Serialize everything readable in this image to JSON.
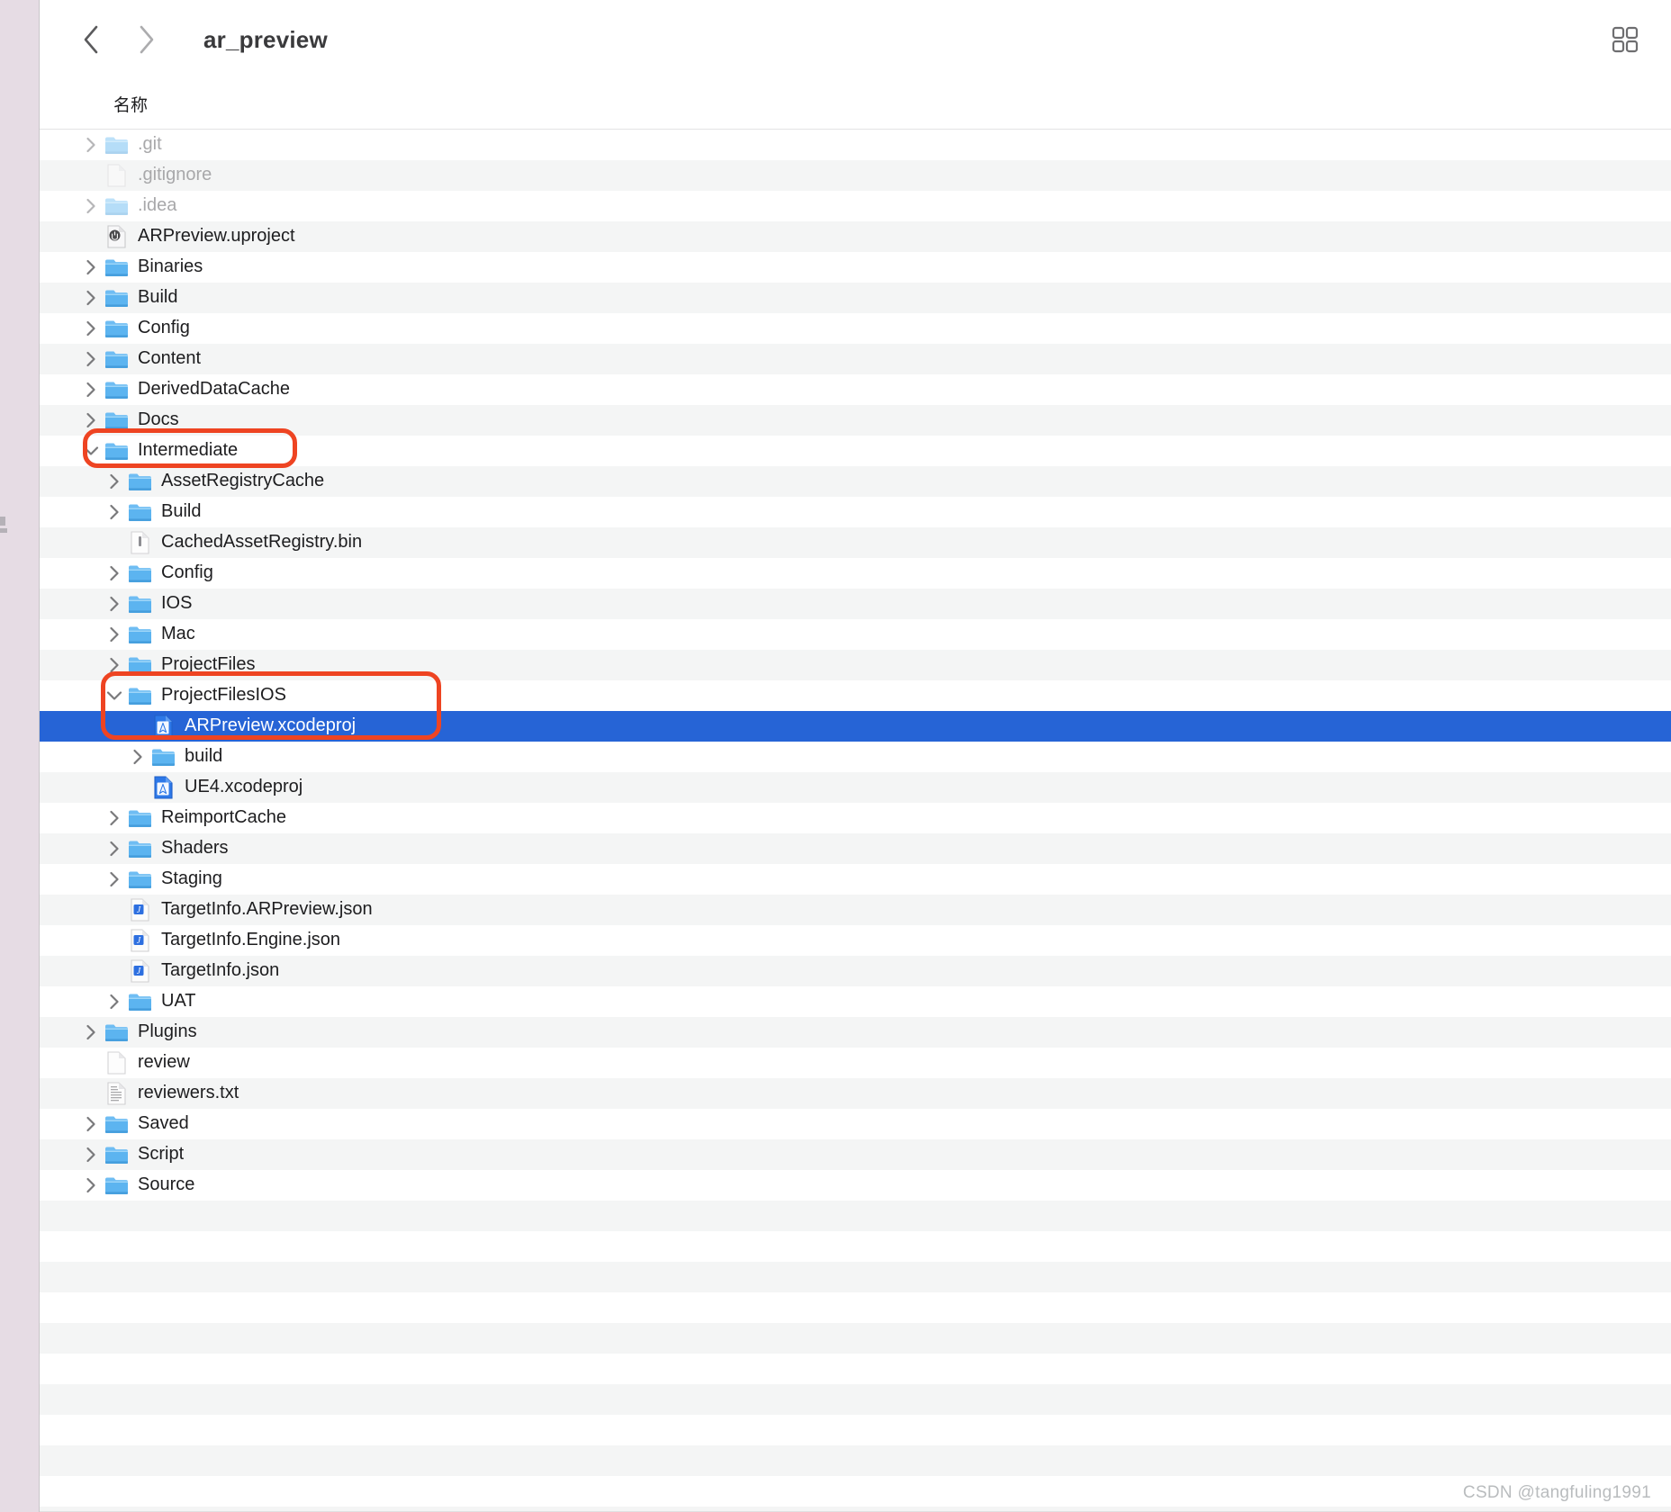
{
  "window": {
    "title": "ar_preview",
    "back_icon": "chevron-left-icon",
    "forward_icon": "chevron-right-icon",
    "view_toggle_icon": "grid-view-icon"
  },
  "column_header": {
    "name": "名称"
  },
  "rows": [
    {
      "name": ".git",
      "indent": 0,
      "type": "folder",
      "state": "collapsed",
      "dim": true,
      "selected": false
    },
    {
      "name": ".gitignore",
      "indent": 0,
      "type": "blankdoc",
      "state": "leaf",
      "dim": true,
      "selected": false
    },
    {
      "name": ".idea",
      "indent": 0,
      "type": "folder",
      "state": "collapsed",
      "dim": true,
      "selected": false
    },
    {
      "name": "ARPreview.uproject",
      "indent": 0,
      "type": "uproject",
      "state": "leaf",
      "dim": false,
      "selected": false
    },
    {
      "name": "Binaries",
      "indent": 0,
      "type": "folder",
      "state": "collapsed",
      "dim": false,
      "selected": false
    },
    {
      "name": "Build",
      "indent": 0,
      "type": "folder",
      "state": "collapsed",
      "dim": false,
      "selected": false
    },
    {
      "name": "Config",
      "indent": 0,
      "type": "folder",
      "state": "collapsed",
      "dim": false,
      "selected": false
    },
    {
      "name": "Content",
      "indent": 0,
      "type": "folder",
      "state": "collapsed",
      "dim": false,
      "selected": false
    },
    {
      "name": "DerivedDataCache",
      "indent": 0,
      "type": "folder",
      "state": "collapsed",
      "dim": false,
      "selected": false
    },
    {
      "name": "Docs",
      "indent": 0,
      "type": "folder",
      "state": "collapsed",
      "dim": false,
      "selected": false
    },
    {
      "name": "Intermediate",
      "indent": 0,
      "type": "folder",
      "state": "expanded",
      "dim": false,
      "selected": false
    },
    {
      "name": "AssetRegistryCache",
      "indent": 1,
      "type": "folder",
      "state": "collapsed",
      "dim": false,
      "selected": false
    },
    {
      "name": "Build",
      "indent": 1,
      "type": "folder",
      "state": "collapsed",
      "dim": false,
      "selected": false
    },
    {
      "name": "CachedAssetRegistry.bin",
      "indent": 1,
      "type": "bin",
      "state": "leaf",
      "dim": false,
      "selected": false
    },
    {
      "name": "Config",
      "indent": 1,
      "type": "folder",
      "state": "collapsed",
      "dim": false,
      "selected": false
    },
    {
      "name": "IOS",
      "indent": 1,
      "type": "folder",
      "state": "collapsed",
      "dim": false,
      "selected": false
    },
    {
      "name": "Mac",
      "indent": 1,
      "type": "folder",
      "state": "collapsed",
      "dim": false,
      "selected": false
    },
    {
      "name": "ProjectFiles",
      "indent": 1,
      "type": "folder",
      "state": "collapsed",
      "dim": false,
      "selected": false
    },
    {
      "name": "ProjectFilesIOS",
      "indent": 1,
      "type": "folder",
      "state": "expanded",
      "dim": false,
      "selected": false
    },
    {
      "name": "ARPreview.xcodeproj",
      "indent": 2,
      "type": "xcodeproj",
      "state": "leaf",
      "dim": false,
      "selected": true
    },
    {
      "name": "build",
      "indent": 2,
      "type": "folder",
      "state": "collapsed",
      "dim": false,
      "selected": false
    },
    {
      "name": "UE4.xcodeproj",
      "indent": 2,
      "type": "xcodeproj",
      "state": "leaf",
      "dim": false,
      "selected": false
    },
    {
      "name": "ReimportCache",
      "indent": 1,
      "type": "folder",
      "state": "collapsed",
      "dim": false,
      "selected": false
    },
    {
      "name": "Shaders",
      "indent": 1,
      "type": "folder",
      "state": "collapsed",
      "dim": false,
      "selected": false
    },
    {
      "name": "Staging",
      "indent": 1,
      "type": "folder",
      "state": "collapsed",
      "dim": false,
      "selected": false
    },
    {
      "name": "TargetInfo.ARPreview.json",
      "indent": 1,
      "type": "json",
      "state": "leaf",
      "dim": false,
      "selected": false
    },
    {
      "name": "TargetInfo.Engine.json",
      "indent": 1,
      "type": "json",
      "state": "leaf",
      "dim": false,
      "selected": false
    },
    {
      "name": "TargetInfo.json",
      "indent": 1,
      "type": "json",
      "state": "leaf",
      "dim": false,
      "selected": false
    },
    {
      "name": "UAT",
      "indent": 1,
      "type": "folder",
      "state": "collapsed",
      "dim": false,
      "selected": false
    },
    {
      "name": "Plugins",
      "indent": 0,
      "type": "folder",
      "state": "collapsed",
      "dim": false,
      "selected": false
    },
    {
      "name": "review",
      "indent": 0,
      "type": "blankdoc",
      "state": "leaf",
      "dim": false,
      "selected": false
    },
    {
      "name": "reviewers.txt",
      "indent": 0,
      "type": "txt",
      "state": "leaf",
      "dim": false,
      "selected": false
    },
    {
      "name": "Saved",
      "indent": 0,
      "type": "folder",
      "state": "collapsed",
      "dim": false,
      "selected": false
    },
    {
      "name": "Script",
      "indent": 0,
      "type": "folder",
      "state": "collapsed",
      "dim": false,
      "selected": false
    },
    {
      "name": "Source",
      "indent": 0,
      "type": "folder",
      "state": "collapsed",
      "dim": false,
      "selected": false
    }
  ],
  "annotations": [
    {
      "id": "annot-intermediate",
      "target": "Intermediate",
      "color": "#EE4422"
    },
    {
      "id": "annot-projfiles",
      "target": "ProjectFilesIOS / ARPreview.xcodeproj",
      "color": "#EE4422"
    }
  ],
  "watermark": {
    "text": "CSDN @tangfuling1991"
  },
  "colors": {
    "selection_blue": "#2664D6",
    "alt_row": "#F4F5F5",
    "sidebar": "#E6DCE4",
    "annotation_red": "#EE4422",
    "folder_blue": "#6BBCF2"
  }
}
